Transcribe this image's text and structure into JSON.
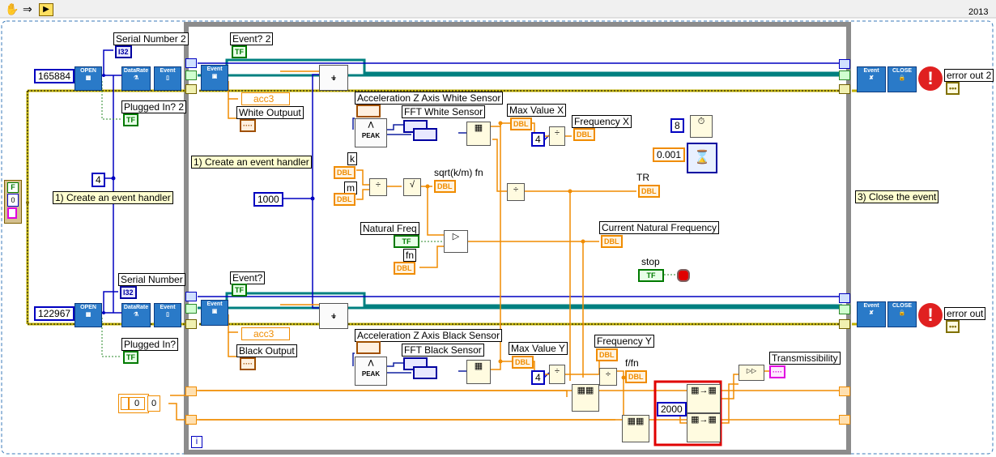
{
  "toolbar": {
    "hand_icon": "hand-icon",
    "arrow_icon": "arrow-icon",
    "highlight_icon": "highlight-icon",
    "version": "2013"
  },
  "colors": {
    "numeric_wire": "#f08c00",
    "integer_wire": "#0000c0",
    "error_wire": "#c0b000",
    "boolean_wire": "#007a00",
    "refnum_wire": "#008080",
    "while_loop_frame": "#909090",
    "highlight_box": "#e00000"
  },
  "left": {
    "serial_a": "165884",
    "serial_b": "122967",
    "rate": "4",
    "cluster_bool": "F",
    "cluster_num": "0",
    "comment": "1) Create an event handler",
    "serial_number_2": "Serial Number 2",
    "serial_number": "Serial Number",
    "plugged_in_2": "Plugged In? 2",
    "plugged_in": "Plugged In?",
    "open": "OPEN",
    "datarate": "DataRate",
    "event": "Event",
    "array_const": "0",
    "array_index": "0"
  },
  "loop": {
    "event_2": "Event? 2",
    "event": "Event?",
    "acc3_top": "acc3",
    "acc3_bottom": "acc3",
    "white_output": "White Outpuut",
    "black_output": "Black Output",
    "comment": "1) Create an event handler",
    "samples": "1000",
    "accel_white": "Acceleration Z Axis White Sensor",
    "accel_black": "Acceleration Z Axis Black Sensor",
    "fft_white": "FFT White Sensor",
    "fft_black": "FFT Black Sensor",
    "max_x": "Max Value X",
    "max_y": "Max Value Y",
    "div_x": "4",
    "div_y": "4",
    "freq_x": "Frequency X",
    "freq_y": "Frequency Y",
    "k": "k",
    "m": "m",
    "sqrt_km": "sqrt(k/m)  fn",
    "tr": "TR",
    "natural_freq": "Natural Freq",
    "fn": "fn",
    "current_nat_freq": "Current Natural Frequency",
    "stop": "stop",
    "timing_const": "8",
    "wait_const": "0.001",
    "ffn": "f/fn",
    "transmissibility": "Transmissibility",
    "array_size": "2000",
    "iteration": "i",
    "peak": "PEAK"
  },
  "right": {
    "comment": "3) Close the event",
    "close": "CLOSE",
    "event": "Event",
    "error_out_2": "error out 2",
    "error_out": "error out"
  },
  "types": {
    "dbl": "DBL",
    "tf": "TF",
    "i32": "I32",
    "wdt": "····",
    "err": "•••"
  }
}
